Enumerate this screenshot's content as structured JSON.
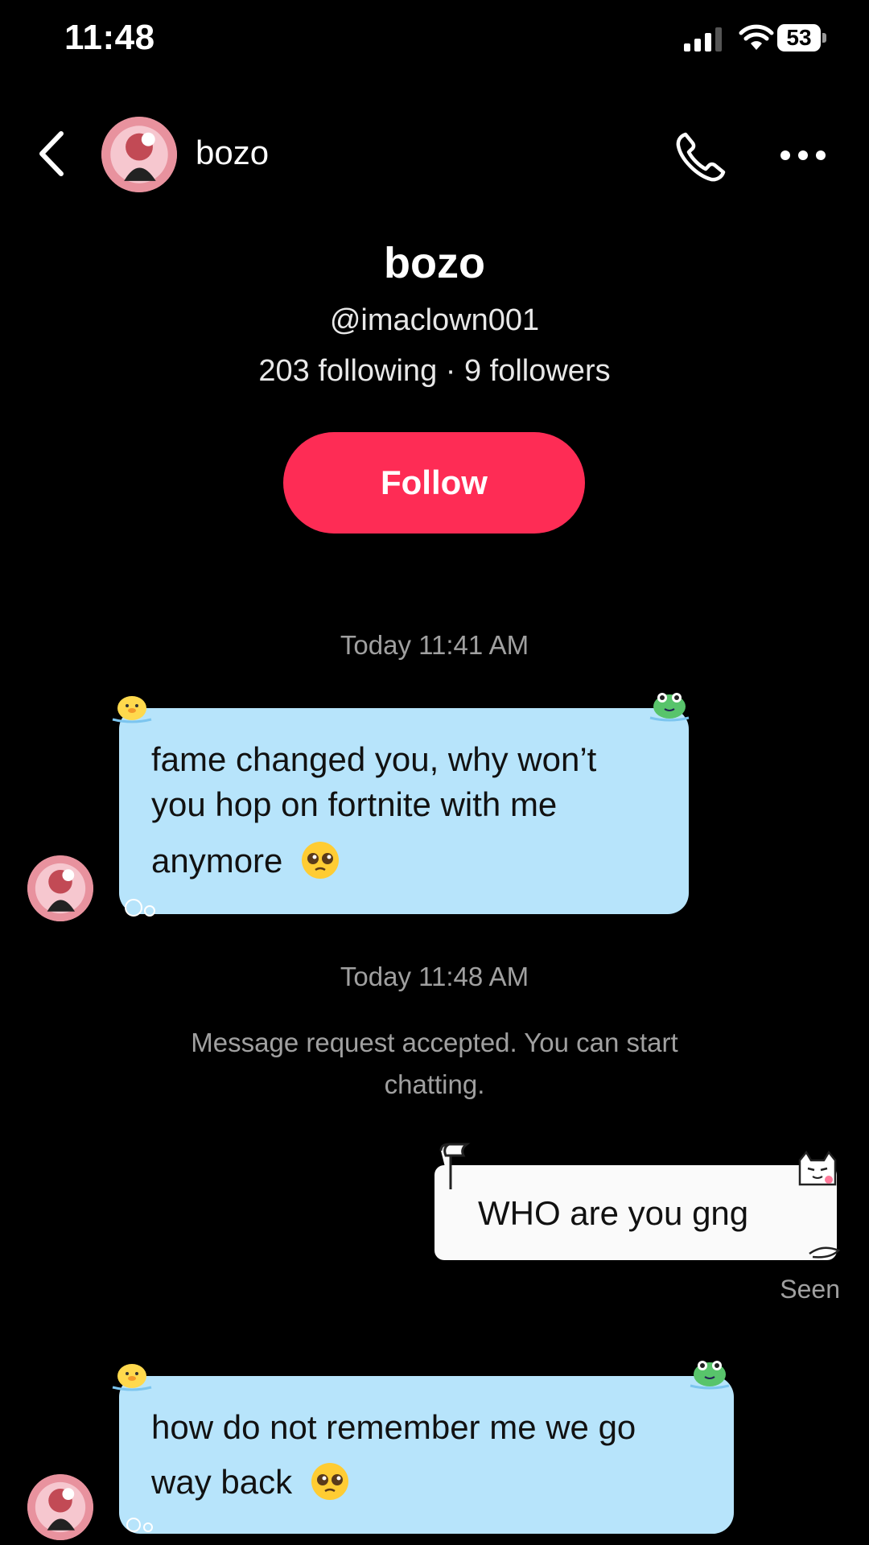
{
  "status_bar": {
    "time": "11:48",
    "battery": "53"
  },
  "header": {
    "username": "bozo"
  },
  "profile": {
    "display_name": "bozo",
    "handle": "@imaclown001",
    "stats": "203 following · 9 followers",
    "follow_label": "Follow"
  },
  "messages": [
    {
      "type": "timestamp",
      "text": "Today 11:41 AM"
    },
    {
      "type": "incoming",
      "lines": [
        "fame changed you, why won’t",
        "you hop on fortnite with me",
        "anymore"
      ]
    },
    {
      "type": "timestamp",
      "text": "Today 11:48 AM"
    },
    {
      "type": "system",
      "lines": [
        "Message request accepted. You can start",
        "chatting."
      ]
    },
    {
      "type": "outgoing",
      "text": "WHO are you gng",
      "status": "Seen"
    },
    {
      "type": "incoming",
      "lines": [
        "how do not remember me we go",
        "way back"
      ]
    }
  ],
  "icons": {
    "back": "chevron-left-icon",
    "call": "phone-icon",
    "more": "more-horizontal-icon",
    "pleading_emoji": "pleading-face-emoji"
  },
  "colors": {
    "follow_button": "#fe2c55",
    "incoming_bubble": "#b7e4fb",
    "outgoing_bubble": "#fafafa",
    "background": "#000000"
  }
}
